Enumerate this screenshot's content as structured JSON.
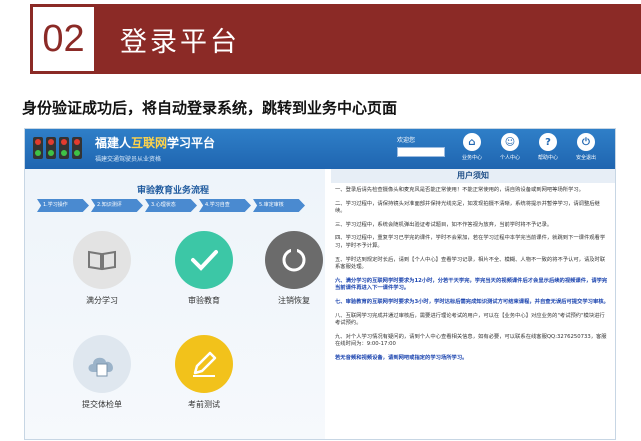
{
  "slide": {
    "number": "02",
    "title": "登录平台",
    "subtitle": "身份验证成功后，将自动登录系统，跳转到业务中心页面"
  },
  "app": {
    "brand_prefix": "福建人",
    "brand_highlight": "互联网",
    "brand_suffix": "学习平台",
    "brand_sub": "福建交通驾驶员从业资格",
    "user_label": "欢迎您"
  },
  "nav": [
    {
      "label": "业务中心",
      "icon": "home-icon",
      "glyph": "⌂"
    },
    {
      "label": "个人中心",
      "icon": "user-icon",
      "glyph": "☺"
    },
    {
      "label": "帮助中心",
      "icon": "help-icon",
      "glyph": "?"
    },
    {
      "label": "安全退出",
      "icon": "power-icon",
      "glyph": "⏻"
    }
  ],
  "flow": {
    "title": "审验教育业务流程",
    "steps": [
      "1.学习操作",
      "2.知识测评",
      "3.心理状态",
      "4.学习自查",
      "5.审定审核"
    ]
  },
  "tiles": [
    {
      "label": "满分学习",
      "icon": "book-icon",
      "color": "#d9d9d9"
    },
    {
      "label": "审验教育",
      "icon": "check-icon",
      "color": "#3cc7a6"
    },
    {
      "label": "注销恢复",
      "icon": "cycle-icon",
      "color": "#6b6b6b"
    },
    {
      "label": "提交体检单",
      "icon": "cloud-doc-icon",
      "color": "#7fa0bf"
    },
    {
      "label": "考前测试",
      "icon": "pencil-icon",
      "color": "#f2c21b"
    }
  ],
  "notice": {
    "title": "用户须知",
    "items": [
      {
        "text": "一、登录后请先检查摄像头和麦克风是否能正常使用！不能正常使用的，请自购设备或到网吧等场所学习。",
        "blue": false
      },
      {
        "text": "二、学习过程中，请保持镜头对准面部并保持光线充足，如发现拍摄不清晰，系统将提示并暂停学习，请调整后继续。",
        "blue": false
      },
      {
        "text": "三、学习过程中，系统会随机弹出验证考试题目，如不作答视为放弃，当前学时将不予记录。",
        "blue": false
      },
      {
        "text": "四、学习过程中，重复学习已学完的课件，学时不会累加，若在学习过程中本学完当前课件，就跳到下一课件观看学习，学时不予计算。",
        "blue": false
      },
      {
        "text": "五、学时达到规定时长后，请到【个人中心】查看学习记录，相片不全、模糊、人物不一致的将不予认可，请及时联系客服处理。",
        "blue": false
      },
      {
        "text": "六、满分学习的互联网学时要求为12小时，分若干天学完，学完当天的视频课件后才会显示后续的视频课件，请学完当前课件再进入下一课件学习。",
        "blue": true
      },
      {
        "text": "七、审验教育的互联网学时要求为3小时，学时达标后需完成知识测试方可结束课程，并自查无误后可提交学习审核。",
        "blue": true
      },
      {
        "text": "八、互联网学习完成并通过审核后，需要进行理论考试的用户，可以在【业务中心】对应业务的\"考试预约\"模块进行考试预约。",
        "blue": false
      },
      {
        "text": "九、对个人学习情况有疑问的，请到个人中心查看相关信息，如有必要，可以联系在线客服QQ:3276250733，客服在线时间为：9:00-17:00",
        "blue": false
      },
      {
        "text": "若无音频和视频设备，请到网吧或指定的学习场所学习。",
        "blue": true
      }
    ]
  }
}
